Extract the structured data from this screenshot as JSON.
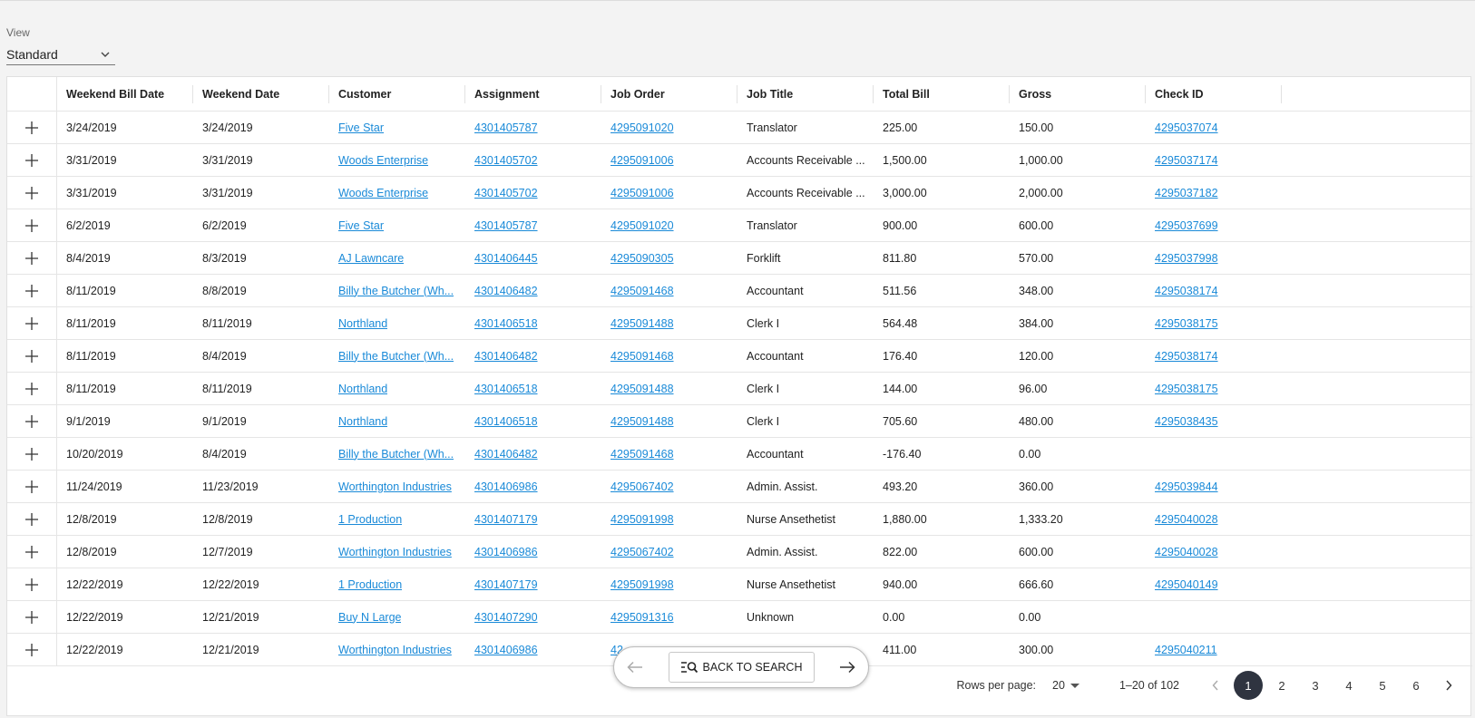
{
  "view": {
    "label": "View",
    "selected": "Standard"
  },
  "columns": [
    "Weekend Bill Date",
    "Weekend Date",
    "Customer",
    "Assignment",
    "Job Order",
    "Job Title",
    "Total Bill",
    "Gross",
    "Check ID"
  ],
  "rows": [
    {
      "weekend_bill_date": "3/24/2019",
      "weekend_date": "3/24/2019",
      "customer": "Five Star",
      "assignment": "4301405787",
      "job_order": "4295091020",
      "job_title": "Translator",
      "total_bill": "225.00",
      "gross": "150.00",
      "check_id": "4295037074"
    },
    {
      "weekend_bill_date": "3/31/2019",
      "weekend_date": "3/31/2019",
      "customer": "Woods Enterprise",
      "assignment": "4301405702",
      "job_order": "4295091006",
      "job_title": "Accounts Receivable ...",
      "total_bill": "1,500.00",
      "gross": "1,000.00",
      "check_id": "4295037174"
    },
    {
      "weekend_bill_date": "3/31/2019",
      "weekend_date": "3/31/2019",
      "customer": "Woods Enterprise",
      "assignment": "4301405702",
      "job_order": "4295091006",
      "job_title": "Accounts Receivable ...",
      "total_bill": "3,000.00",
      "gross": "2,000.00",
      "check_id": "4295037182"
    },
    {
      "weekend_bill_date": "6/2/2019",
      "weekend_date": "6/2/2019",
      "customer": "Five Star",
      "assignment": "4301405787",
      "job_order": "4295091020",
      "job_title": "Translator",
      "total_bill": "900.00",
      "gross": "600.00",
      "check_id": "4295037699"
    },
    {
      "weekend_bill_date": "8/4/2019",
      "weekend_date": "8/3/2019",
      "customer": "AJ Lawncare",
      "assignment": "4301406445",
      "job_order": "4295090305",
      "job_title": "Forklift",
      "total_bill": "811.80",
      "gross": "570.00",
      "check_id": "4295037998"
    },
    {
      "weekend_bill_date": "8/11/2019",
      "weekend_date": "8/8/2019",
      "customer": "Billy the Butcher (Wh...",
      "assignment": "4301406482",
      "job_order": "4295091468",
      "job_title": "Accountant",
      "total_bill": "511.56",
      "gross": "348.00",
      "check_id": "4295038174"
    },
    {
      "weekend_bill_date": "8/11/2019",
      "weekend_date": "8/11/2019",
      "customer": "Northland",
      "assignment": "4301406518",
      "job_order": "4295091488",
      "job_title": "Clerk I",
      "total_bill": "564.48",
      "gross": "384.00",
      "check_id": "4295038175"
    },
    {
      "weekend_bill_date": "8/11/2019",
      "weekend_date": "8/4/2019",
      "customer": "Billy the Butcher (Wh...",
      "assignment": "4301406482",
      "job_order": "4295091468",
      "job_title": "Accountant",
      "total_bill": "176.40",
      "gross": "120.00",
      "check_id": "4295038174"
    },
    {
      "weekend_bill_date": "8/11/2019",
      "weekend_date": "8/11/2019",
      "customer": "Northland",
      "assignment": "4301406518",
      "job_order": "4295091488",
      "job_title": "Clerk I",
      "total_bill": "144.00",
      "gross": "96.00",
      "check_id": "4295038175"
    },
    {
      "weekend_bill_date": "9/1/2019",
      "weekend_date": "9/1/2019",
      "customer": "Northland",
      "assignment": "4301406518",
      "job_order": "4295091488",
      "job_title": "Clerk I",
      "total_bill": "705.60",
      "gross": "480.00",
      "check_id": "4295038435"
    },
    {
      "weekend_bill_date": "10/20/2019",
      "weekend_date": "8/4/2019",
      "customer": "Billy the Butcher (Wh...",
      "assignment": "4301406482",
      "job_order": "4295091468",
      "job_title": "Accountant",
      "total_bill": "-176.40",
      "gross": "0.00",
      "check_id": ""
    },
    {
      "weekend_bill_date": "11/24/2019",
      "weekend_date": "11/23/2019",
      "customer": "Worthington Industries",
      "assignment": "4301406986",
      "job_order": "4295067402",
      "job_title": "Admin. Assist.",
      "total_bill": "493.20",
      "gross": "360.00",
      "check_id": "4295039844"
    },
    {
      "weekend_bill_date": "12/8/2019",
      "weekend_date": "12/8/2019",
      "customer": "1 Production",
      "assignment": "4301407179",
      "job_order": "4295091998",
      "job_title": "Nurse Ansethetist",
      "total_bill": "1,880.00",
      "gross": "1,333.20",
      "check_id": "4295040028"
    },
    {
      "weekend_bill_date": "12/8/2019",
      "weekend_date": "12/7/2019",
      "customer": "Worthington Industries",
      "assignment": "4301406986",
      "job_order": "4295067402",
      "job_title": "Admin. Assist.",
      "total_bill": "822.00",
      "gross": "600.00",
      "check_id": "4295040028"
    },
    {
      "weekend_bill_date": "12/22/2019",
      "weekend_date": "12/22/2019",
      "customer": "1 Production",
      "assignment": "4301407179",
      "job_order": "4295091998",
      "job_title": "Nurse Ansethetist",
      "total_bill": "940.00",
      "gross": "666.60",
      "check_id": "4295040149"
    },
    {
      "weekend_bill_date": "12/22/2019",
      "weekend_date": "12/21/2019",
      "customer": "Buy N Large",
      "assignment": "4301407290",
      "job_order": "4295091316",
      "job_title": "Unknown",
      "total_bill": "0.00",
      "gross": "0.00",
      "check_id": ""
    },
    {
      "weekend_bill_date": "12/22/2019",
      "weekend_date": "12/21/2019",
      "customer": "Worthington Industries",
      "assignment": "4301406986",
      "job_order": "42",
      "job_title": "",
      "total_bill": "411.00",
      "gross": "300.00",
      "check_id": "4295040211"
    }
  ],
  "pagination": {
    "rows_per_page_label": "Rows per page:",
    "rows_per_page": "20",
    "range": "1–20 of 102",
    "pages": [
      "1",
      "2",
      "3",
      "4",
      "5",
      "6"
    ],
    "current_page": "1"
  },
  "floating_bar": {
    "back_label": "BACK TO SEARCH"
  },
  "colors": {
    "link": "#1a8ad8",
    "active_page": "#2f3440"
  }
}
